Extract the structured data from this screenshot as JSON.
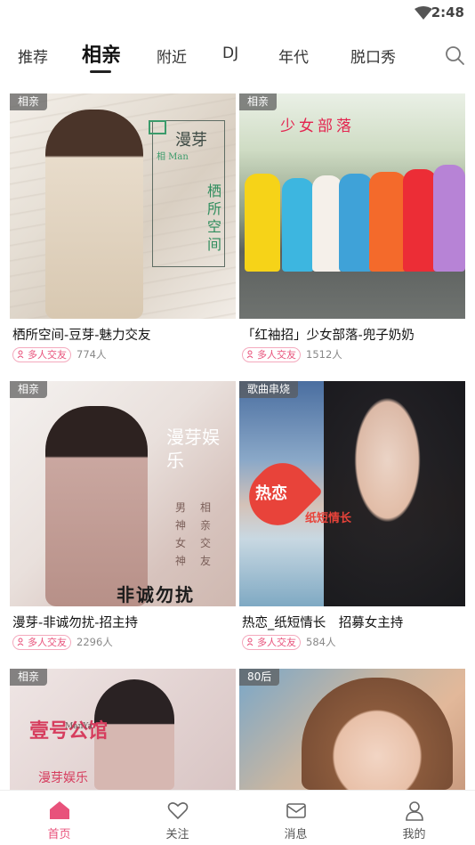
{
  "status_bar": {
    "time": "2:48"
  },
  "tabs": [
    {
      "label": "推荐"
    },
    {
      "label": "相亲",
      "active": true
    },
    {
      "label": "附近"
    },
    {
      "label": "DJ"
    },
    {
      "label": "年代"
    },
    {
      "label": "脱口秀"
    }
  ],
  "search_icon": "search-icon",
  "accent_color": "#e8527b",
  "cards": [
    {
      "category": "相亲",
      "title": "栖所空间-豆芽-魅力交友",
      "tag": "多人交友",
      "count": "774人",
      "overlay": [
        "漫芽",
        "相 Man",
        "栖所空间"
      ]
    },
    {
      "category": "相亲",
      "title": "「红袖招」少女部落-兜子奶奶",
      "tag": "多人交友",
      "count": "1512人",
      "overlay": [
        "少女部落"
      ]
    },
    {
      "category": "相亲",
      "title": "漫芽-非诚勿扰-招主持",
      "tag": "多人交友",
      "count": "2296人",
      "overlay": [
        "漫芽娱乐",
        "男神 女神",
        "相亲 交友",
        "非诚勿扰"
      ]
    },
    {
      "category": "歌曲串烧",
      "title": "热恋_纸短情长　招募女主持",
      "tag": "多人交友",
      "count": "584人",
      "overlay": [
        "热恋",
        "纸短情长"
      ]
    },
    {
      "category": "相亲",
      "title": "",
      "tag": "",
      "count": "",
      "overlay": [
        "壹号公馆",
        "ManYa",
        "漫芽娱乐"
      ]
    },
    {
      "category": "80后",
      "title": "",
      "tag": "",
      "count": "",
      "overlay": []
    }
  ],
  "bottom_nav": [
    {
      "label": "首页",
      "icon": "home-icon",
      "active": true
    },
    {
      "label": "关注",
      "icon": "heart-icon"
    },
    {
      "label": "消息",
      "icon": "mail-icon"
    },
    {
      "label": "我的",
      "icon": "user-icon"
    }
  ]
}
